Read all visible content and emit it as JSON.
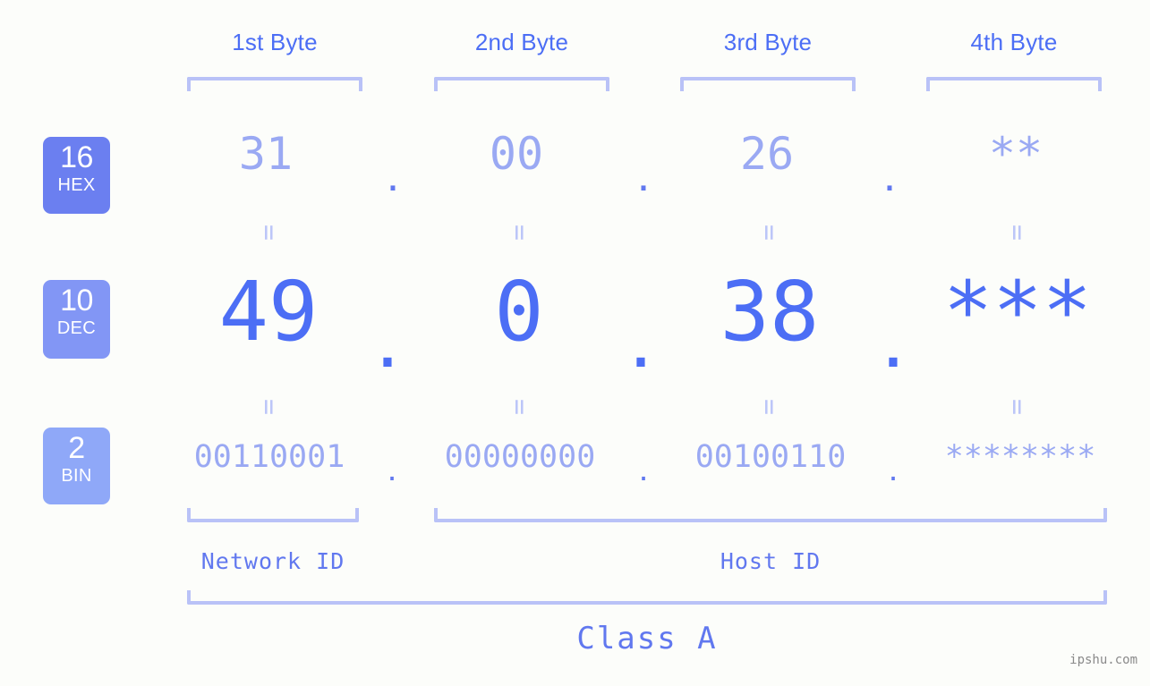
{
  "background_color": "#fcfdfa",
  "accent_color": "#4c6ef5",
  "muted_accent_color": "#9aa9f3",
  "bracket_color": "#b9c2f7",
  "byte_headers": [
    {
      "label": "1st Byte"
    },
    {
      "label": "2nd Byte"
    },
    {
      "label": "3rd Byte"
    },
    {
      "label": "4th Byte"
    }
  ],
  "rows": [
    {
      "radix_number": "16",
      "radix_label": "HEX",
      "badge_color": "#6b7ff0",
      "values": [
        "31",
        "00",
        "26",
        "**"
      ],
      "separators": [
        ".",
        ".",
        "."
      ]
    },
    {
      "radix_number": "10",
      "radix_label": "DEC",
      "badge_color": "#8296f5",
      "values": [
        "49",
        "0",
        "38",
        "***"
      ],
      "separators": [
        ".",
        ".",
        "."
      ]
    },
    {
      "radix_number": "2",
      "radix_label": "BIN",
      "badge_color": "#8fa8f8",
      "values": [
        "00110001",
        "00000000",
        "00100110",
        "********"
      ],
      "separators": [
        ".",
        ".",
        "."
      ]
    }
  ],
  "equals_marks": {
    "glyph": "=",
    "count_per_gap": 4,
    "gaps": 2
  },
  "sections": {
    "network_id": "Network ID",
    "host_id": "Host ID",
    "class": "Class A"
  },
  "watermark": "ipshu.com"
}
